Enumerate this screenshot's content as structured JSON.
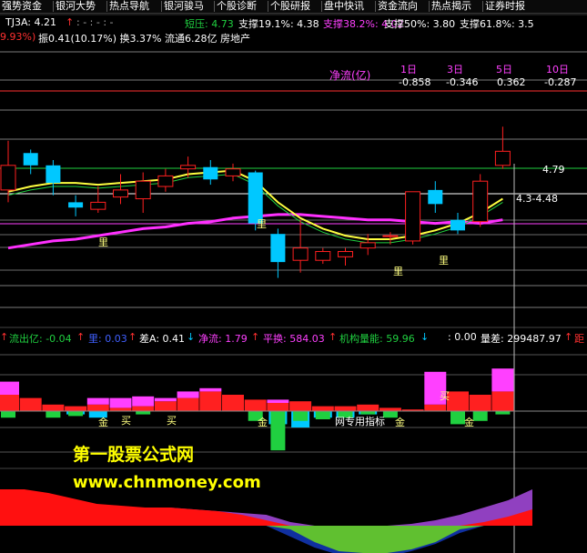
{
  "menu": [
    "强势资金",
    "银河大势",
    "热点导航",
    "银河骏马",
    "个股诊断",
    "个股研报",
    "盘中快讯",
    "资金流向",
    "热点揭示",
    "证券时报"
  ],
  "header": {
    "ind": "TJ3A: 4.21",
    "dashes": ": -  : -  : -",
    "duan_ya": "短压: 4.73",
    "zc191": "支撑19.1%: 4.38",
    "zc382": "支撑38.2%: 4.02",
    "zc50": "支撑50%: 3.80",
    "zc618": "支撑61.8%: 3.5",
    "row2_pct": "9.93%)",
    "row2_info": "振0.41(10.17%) 换3.37% 流通6.28亿 房地产"
  },
  "net_flow": {
    "title": "净流(亿)",
    "periods": [
      "1日",
      "3日",
      "5日",
      "10日"
    ],
    "values": [
      "-0.858",
      "-0.346",
      "0.362",
      "-0.287"
    ]
  },
  "price_labels": {
    "p479": "4.79",
    "p448": "4.3-4.48"
  },
  "li_marks": [
    "里",
    "里",
    "里",
    "里"
  ],
  "mid_header": {
    "liuchu": "流出亿: -0.04",
    "l2": "里: 0.03",
    "chaA": "差A: 0.41",
    "jingliu": "净流: 1.79",
    "pinghuan": "平换: 584.03",
    "jigou": "机构量能: 59.96",
    "zero": ": 0.00",
    "liangcha": "量差: 299487.97",
    "ju": "距"
  },
  "mid_marks": [
    "金",
    "买",
    "买",
    "金",
    "金",
    "买",
    "金"
  ],
  "mid_note": "网专用指标",
  "watermark": {
    "cn": "第一股票公式网",
    "en": "www.chnmoney.com"
  },
  "colors": {
    "up": "#ff2020",
    "down": "#00c8ff",
    "ma_yellow": "#ffff40",
    "ma_magenta": "#ff30ff",
    "green": "#20d040",
    "magenta_bar": "#ff40ff"
  },
  "chart_data": [
    {
      "type": "candlestick",
      "candles": [
        {
          "o": 4.43,
          "c": 4.57,
          "h": 4.71,
          "l": 4.36
        },
        {
          "o": 4.64,
          "c": 4.57,
          "h": 4.66,
          "l": 4.52
        },
        {
          "o": 4.57,
          "c": 4.47,
          "h": 4.6,
          "l": 4.4
        },
        {
          "o": 4.36,
          "c": 4.33,
          "h": 4.4,
          "l": 4.28
        },
        {
          "o": 4.32,
          "c": 4.36,
          "h": 4.45,
          "l": 4.3
        },
        {
          "o": 4.39,
          "c": 4.43,
          "h": 4.52,
          "l": 4.35
        },
        {
          "o": 4.38,
          "c": 4.48,
          "h": 4.53,
          "l": 4.3
        },
        {
          "o": 4.45,
          "c": 4.51,
          "h": 4.55,
          "l": 4.42
        },
        {
          "o": 4.55,
          "c": 4.57,
          "h": 4.62,
          "l": 4.5
        },
        {
          "o": 4.56,
          "c": 4.49,
          "h": 4.6,
          "l": 4.46
        },
        {
          "o": 4.51,
          "c": 4.55,
          "h": 4.58,
          "l": 4.48
        },
        {
          "o": 4.53,
          "c": 4.24,
          "h": 4.54,
          "l": 4.2
        },
        {
          "o": 4.18,
          "c": 4.02,
          "h": 4.21,
          "l": 3.93
        },
        {
          "o": 4.03,
          "c": 4.1,
          "h": 4.26,
          "l": 3.96
        },
        {
          "o": 4.03,
          "c": 4.08,
          "h": 4.1,
          "l": 4.01
        },
        {
          "o": 4.05,
          "c": 4.08,
          "h": 4.1,
          "l": 4.0
        },
        {
          "o": 4.1,
          "c": 4.13,
          "h": 4.18,
          "l": 4.06
        },
        {
          "o": 4.17,
          "c": 4.17,
          "h": 4.19,
          "l": 4.12
        },
        {
          "o": 4.14,
          "c": 4.42,
          "h": 4.42,
          "l": 4.12
        },
        {
          "o": 4.43,
          "c": 4.35,
          "h": 4.48,
          "l": 4.3
        },
        {
          "o": 4.26,
          "c": 4.2,
          "h": 4.3,
          "l": 4.18
        },
        {
          "o": 4.25,
          "c": 4.48,
          "h": 4.52,
          "l": 4.22
        },
        {
          "o": 4.57,
          "c": 4.65,
          "h": 4.79,
          "l": 4.55
        }
      ],
      "ma_yellow": [
        4.42,
        4.45,
        4.47,
        4.47,
        4.46,
        4.47,
        4.48,
        4.49,
        4.52,
        4.53,
        4.54,
        4.48,
        4.36,
        4.27,
        4.21,
        4.17,
        4.15,
        4.15,
        4.17,
        4.2,
        4.24,
        4.3,
        4.38
      ],
      "ma_magenta": [
        4.1,
        4.12,
        4.14,
        4.15,
        4.17,
        4.19,
        4.21,
        4.22,
        4.24,
        4.25,
        4.27,
        4.28,
        4.29,
        4.29,
        4.28,
        4.27,
        4.26,
        4.26,
        4.25,
        4.24,
        4.25,
        4.24,
        4.26
      ],
      "ylim": [
        3.7,
        5.2
      ]
    },
    {
      "type": "bar",
      "red": [
        0.5,
        0.4,
        0.2,
        0.15,
        0.2,
        0.1,
        0.15,
        0.3,
        0.4,
        0.6,
        0.5,
        0.35,
        0.25,
        0.3,
        0.15,
        0.15,
        0.2,
        0.1,
        0.05,
        0.2,
        0.6,
        0.5,
        0.6
      ],
      "magenta": [
        0.4,
        0,
        0,
        0,
        0.2,
        0.3,
        0.3,
        0.1,
        0.2,
        0.1,
        0,
        0,
        0.1,
        0,
        0,
        0,
        0,
        0,
        0,
        1.0,
        0,
        0,
        0.7
      ],
      "green": [
        0.2,
        0,
        0.2,
        0.15,
        0,
        0,
        0.1,
        0,
        0,
        0,
        0,
        0.3,
        1.2,
        0.3,
        0.25,
        0.2,
        0.1,
        0.2,
        0,
        0,
        0.4,
        0.3,
        0.1
      ],
      "cyan": [
        0,
        0,
        0,
        0.1,
        0.2,
        0,
        0,
        0,
        0,
        0,
        0,
        0,
        0.4,
        0.5,
        0.2,
        0.2,
        0.1,
        0,
        0,
        0,
        0,
        0,
        0
      ]
    },
    {
      "type": "area",
      "red": [
        1.0,
        1.0,
        0.9,
        0.75,
        0.6,
        0.55,
        0.5,
        0.5,
        0.45,
        0.4,
        0.3,
        0.15,
        0,
        0,
        0,
        0,
        0,
        0,
        0,
        0,
        0.1,
        0.25,
        0.45
      ],
      "blue": [
        0,
        0,
        0,
        0,
        0,
        0,
        0,
        0,
        0,
        0,
        0,
        0,
        -0.3,
        -0.6,
        -0.8,
        -0.85,
        -0.85,
        -0.7,
        -0.5,
        -0.2,
        0,
        0,
        0
      ],
      "green": [
        0,
        0,
        0,
        0,
        0,
        0,
        0,
        0,
        0,
        0,
        0,
        0,
        -0.1,
        -0.45,
        -0.7,
        -0.75,
        -0.75,
        -0.65,
        -0.45,
        -0.1,
        0,
        0,
        0
      ],
      "purple": [
        0.2,
        0.25,
        0.3,
        0.3,
        0.35,
        0.4,
        0.45,
        0.5,
        0.45,
        0.4,
        0.35,
        0.3,
        0.1,
        0,
        0,
        0,
        0,
        0.05,
        0.15,
        0.3,
        0.5,
        0.7,
        1.0
      ]
    }
  ]
}
